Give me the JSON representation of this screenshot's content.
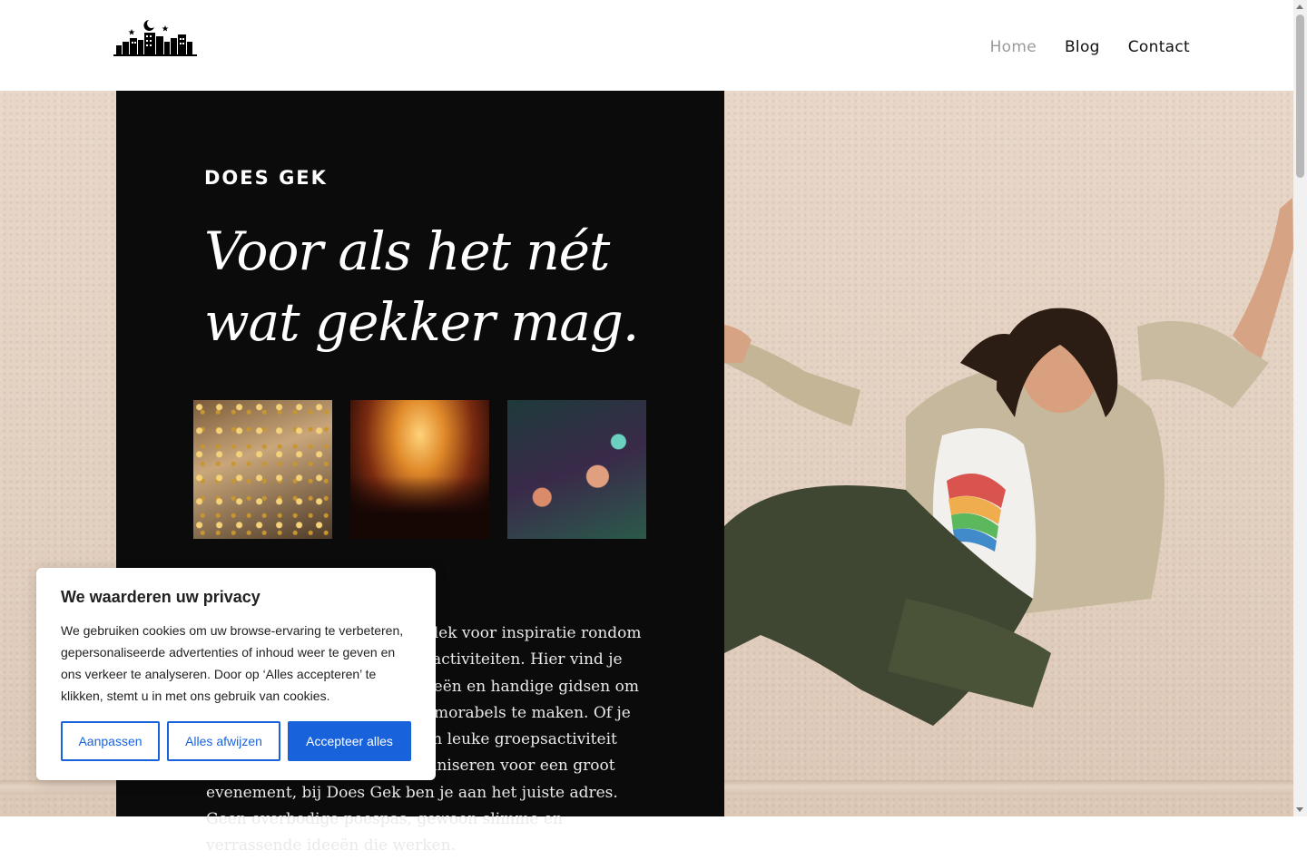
{
  "site": {
    "logo_icon": "city-skyline-moon-icon"
  },
  "nav": {
    "items": [
      {
        "label": "Home",
        "active": true
      },
      {
        "label": "Blog",
        "active": false
      },
      {
        "label": "Contact",
        "active": false
      }
    ]
  },
  "hero": {
    "eyebrow": "DOES GEK",
    "headline": "Voor als het nét wat gekker mag.",
    "body": "Welkom bij Does Gek, jouw plek voor inspiratie rondom feesten, uitjes en bijzondere activiteiten. Hier vind je praktische tips, creatieve ideeën en handige gidsen om van elke gelegenheid iets memorabels te maken. Of je nu een klein feestje plant, een leuke groepsactiviteit zoekt, of iets unieks wilt organiseren voor een groot evenement, bij Does Gek ben je aan het juiste adres. Geen overbodige poespas, gewoon slimme en verrassende ideeën die werken."
  },
  "thumbnails": [
    {
      "name": "champagne-toast-image"
    },
    {
      "name": "concert-crowd-image"
    },
    {
      "name": "dance-party-image"
    }
  ],
  "cookie": {
    "title": "We waarderen uw privacy",
    "text": "We gebruiken cookies om uw browse-ervaring te verbeteren, gepersonaliseerde advertenties of inhoud weer te geven en ons verkeer te analyseren. Door op ‘Alles accepteren’ te klikken, stemt u in met ons gebruik van cookies.",
    "customize_label": "Aanpassen",
    "reject_label": "Alles afwijzen",
    "accept_label": "Accepteer alles",
    "accent": "#1863dc"
  },
  "colors": {
    "panel": "#0b0b0b",
    "nav_active": "#9a9a9a",
    "text": "#111111"
  }
}
